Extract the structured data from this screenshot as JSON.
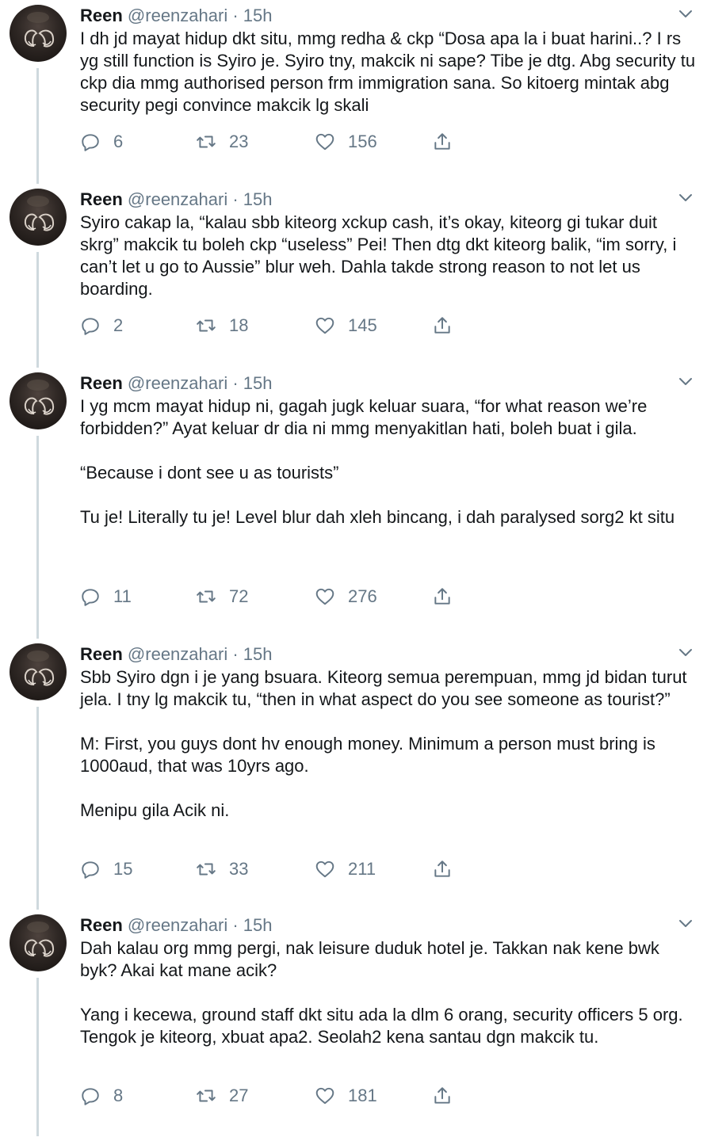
{
  "tweets": [
    {
      "name": "Reen",
      "handle": "@reenzahari",
      "separator": "·",
      "time": "15h",
      "paragraphs": [
        "I dh jd mayat hidup dkt situ, mmg redha & ckp “Dosa apa la i buat harini..? I rs yg still function is Syiro je. Syiro tny, makcik ni sape? Tibe je dtg. Abg security tu ckp dia mmg authorised person frm immigration sana. So kitoerg mintak abg security pegi convince makcik lg skali"
      ],
      "replies": "6",
      "retweets": "23",
      "likes": "156"
    },
    {
      "name": "Reen",
      "handle": "@reenzahari",
      "separator": "·",
      "time": "15h",
      "paragraphs": [
        "Syiro cakap la, “kalau sbb kiteorg xckup cash, it’s okay, kiteorg gi tukar duit skrg” makcik tu boleh ckp “useless” Pei! Then dtg dkt kiteorg balik, “im sorry, i can’t let u go to Aussie” blur weh. Dahla takde strong reason to not let us boarding."
      ],
      "replies": "2",
      "retweets": "18",
      "likes": "145"
    },
    {
      "name": "Reen",
      "handle": "@reenzahari",
      "separator": "·",
      "time": "15h",
      "paragraphs": [
        "I yg mcm mayat hidup ni, gagah jugk keluar suara, “for what reason we’re forbidden?” Ayat keluar dr dia ni mmg menyakitlan hati, boleh buat i gila.",
        "“Because i dont see u as tourists”",
        "Tu je! Literally tu je! Level blur dah xleh bincang, i dah paralysed sorg2 kt situ"
      ],
      "replies": "11",
      "retweets": "72",
      "likes": "276"
    },
    {
      "name": "Reen",
      "handle": "@reenzahari",
      "separator": "·",
      "time": "15h",
      "paragraphs": [
        "Sbb Syiro dgn i je yang bsuara. Kiteorg semua perempuan, mmg jd bidan turut jela. I tny lg makcik tu, “then in what aspect do you see someone as tourist?”",
        "M: First, you guys dont hv enough money. Minimum a person must bring is 1000aud, that was 10yrs ago.",
        "Menipu gila Acik ni."
      ],
      "replies": "15",
      "retweets": "33",
      "likes": "211"
    },
    {
      "name": "Reen",
      "handle": "@reenzahari",
      "separator": "·",
      "time": "15h",
      "paragraphs": [
        "Dah kalau org mmg pergi, nak leisure duduk hotel je. Takkan nak kene bwk byk? Akai kat mane acik?",
        "Yang i kecewa, ground staff dkt situ ada la dlm 6 orang, security officers 5 org. Tengok je kiteorg, xbuat apa2. Seolah2 kena santau dgn makcik tu."
      ],
      "replies": "8",
      "retweets": "27",
      "likes": "181"
    }
  ],
  "icons": {
    "reply": "speech-bubble-icon",
    "retweet": "retweet-icon",
    "like": "heart-icon",
    "share": "share-icon",
    "menu": "chevron-down-icon"
  },
  "colors": {
    "text": "#14171a",
    "secondary": "#657786",
    "thread_line": "#cfd9de"
  }
}
